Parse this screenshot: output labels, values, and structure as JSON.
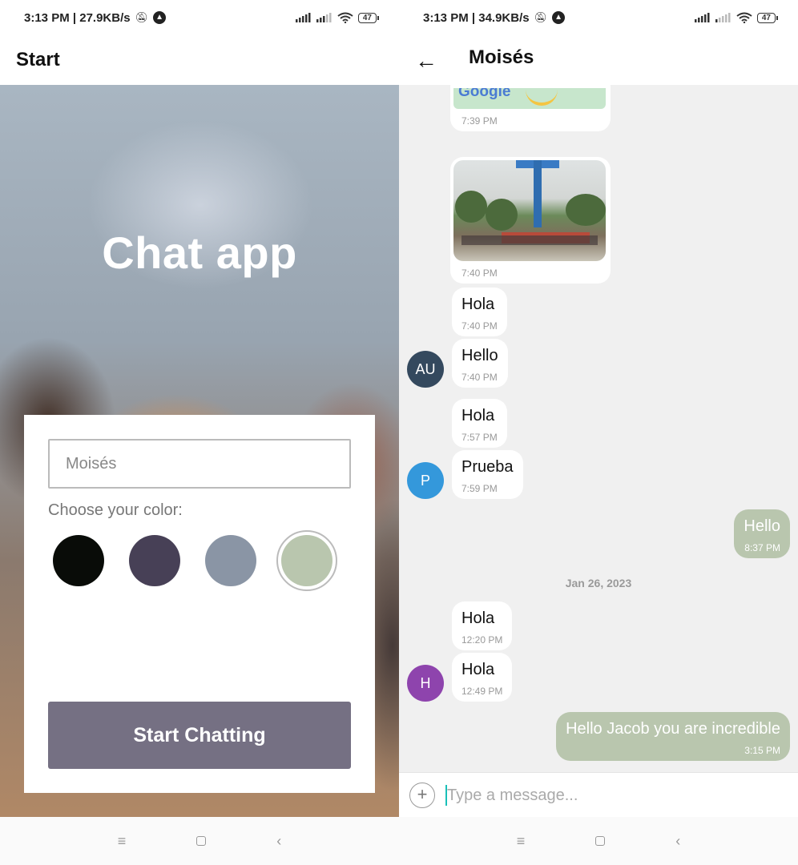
{
  "left": {
    "status": {
      "time_speed": "3:13 PM | 27.9KB/s",
      "battery": "47"
    },
    "title": "Start",
    "hero_title": "Chat app",
    "name_input": {
      "value": "Moisés"
    },
    "color_label": "Choose your color:",
    "colors": [
      "#090C08",
      "#474056",
      "#8A95A5",
      "#B9C6AE"
    ],
    "selected_color": "#B9C6AE",
    "start_button": {
      "label": "Start Chatting",
      "color": "#757083"
    }
  },
  "right": {
    "status": {
      "time_speed": "3:13 PM | 34.9KB/s",
      "battery": "47"
    },
    "title": "Moisés",
    "messages": [
      {
        "type": "map",
        "image_text": "Google",
        "time": "7:39 PM"
      },
      {
        "type": "image",
        "time": "7:40 PM"
      },
      {
        "type": "text",
        "text": "Hola",
        "time": "7:40 PM"
      },
      {
        "type": "text",
        "text": "Hello",
        "time": "7:40 PM",
        "avatar": "AU"
      },
      {
        "type": "text",
        "text": "Hola",
        "time": "7:57 PM"
      },
      {
        "type": "text",
        "text": "Prueba",
        "time": "7:59 PM",
        "avatar": "P"
      },
      {
        "type": "outgoing",
        "text": "Hello",
        "time": "8:37 PM"
      },
      {
        "type": "text",
        "text": "Hola",
        "time": "12:20 PM"
      },
      {
        "type": "text",
        "text": "Hola",
        "time": "12:49 PM",
        "avatar": "H"
      },
      {
        "type": "outgoing",
        "text": "Hello Jacob you are incredible",
        "time": "3:15 PM"
      }
    ],
    "date_separator": "Jan 26, 2023",
    "avatar_colors": {
      "AU": "#34495e",
      "P": "#3498db",
      "H": "#8e44ad"
    },
    "outgoing_color": "#B9C6AE",
    "composer": {
      "placeholder": "Type a message..."
    }
  },
  "icons": [
    "back-arrow-icon",
    "add-icon",
    "wifi-icon",
    "signal-icon",
    "battery-icon",
    "menu-icon",
    "home-icon",
    "back-icon"
  ]
}
